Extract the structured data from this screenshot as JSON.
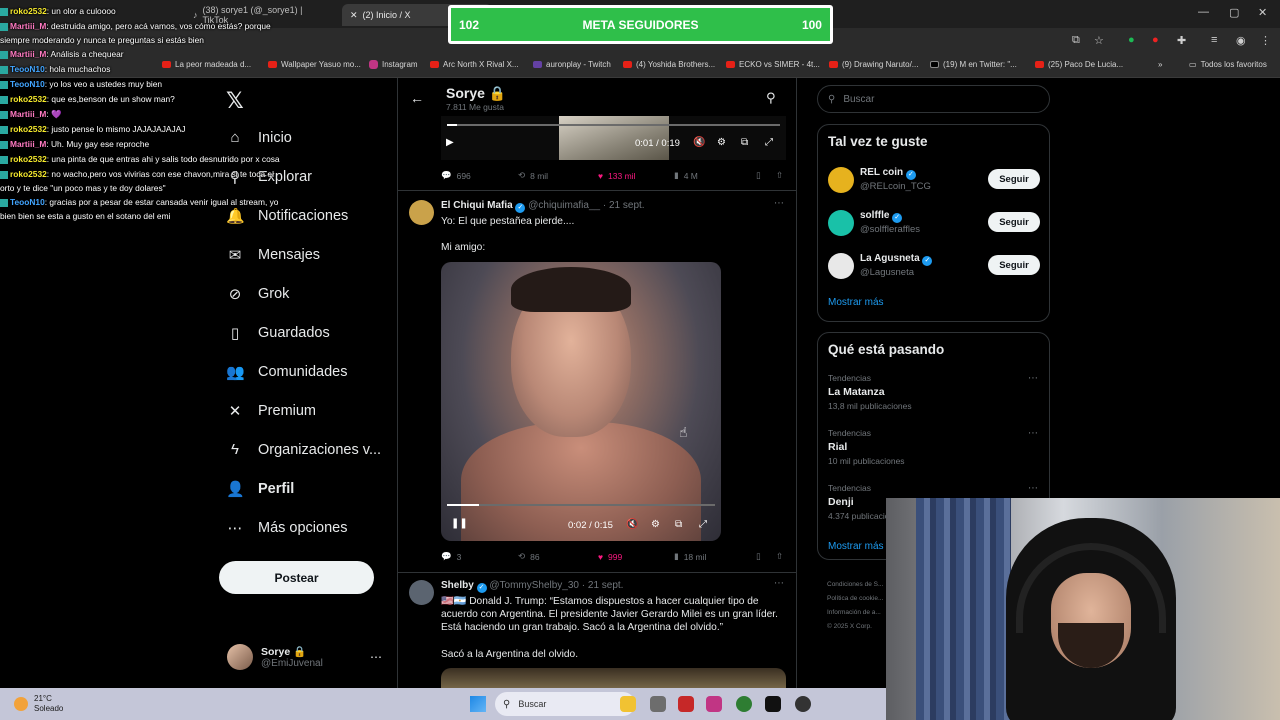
{
  "browser": {
    "tabs": [
      {
        "label": "(38) sorye1 (@_sorye1) | TikTok",
        "active": false
      },
      {
        "label": "(2) Inicio / X",
        "active": true
      }
    ],
    "bookmarks": [
      "La peor madeada d...",
      "Wallpaper Yasuo mo...",
      "Instagram",
      "Arc North X Rival X...",
      "auronplay - Twitch",
      "(4) Yoshida Brothers...",
      "ECKO vs SIMER - 4t...",
      "(9) Drawing Naruto/...",
      "(19) M en Twitter: \"...",
      "(25) Paco De Lucia...",
      "Todos los favoritos"
    ]
  },
  "goal": {
    "left": "102",
    "label": "META SEGUIDORES",
    "right": "100"
  },
  "chat": [
    {
      "user": "roko2532",
      "msg": ": un olor a culoooo",
      "color": "roko"
    },
    {
      "user": "Martiii_M",
      "msg": ": destruida amigo, pero acá vamos, vos cómo estás? porque siempre moderando y nunca te preguntas si estás bien",
      "color": "mar",
      "wrap": true
    },
    {
      "user": "Martiii_M",
      "msg": ": Análisis a chequear",
      "color": "mar"
    },
    {
      "user": "TeooN10",
      "msg": ": hola muchachos",
      "color": "teo"
    },
    {
      "user": "TeooN10",
      "msg": ": yo los veo a ustedes muy bien",
      "color": "teo"
    },
    {
      "user": "roko2532",
      "msg": ": que es,benson de un show man?",
      "color": "roko"
    },
    {
      "user": "Martiii_M",
      "msg": ": 💜",
      "color": "mar"
    },
    {
      "user": "roko2532",
      "msg": ": justo pense lo mismo JAJAJAJAJAJ",
      "color": "roko"
    },
    {
      "user": "Martiii_M",
      "msg": ": Uh. Muy gay ese reproche",
      "color": "mar"
    },
    {
      "user": "roko2532",
      "msg": ": una pinta de que entras ahi y salis todo desnutrido por x cosa",
      "color": "roko"
    },
    {
      "user": "roko2532",
      "msg": ": no wacho,pero vos vivirias con ese chavon,mira si te toca el orto y te dice \"un poco mas y te doy dolares\"",
      "color": "roko",
      "wrap": true
    },
    {
      "user": "TeooN10",
      "msg": ": gracias por a pesar de estar cansada venir igual al stream, yo bien bien se esta a gusto en el sotano del emi",
      "color": "teo",
      "wrap": true
    }
  ],
  "nav": {
    "items": [
      {
        "label": "Inicio",
        "icon": "home-icon",
        "glyph": "⌂"
      },
      {
        "label": "Explorar",
        "icon": "search-icon",
        "glyph": "⚲"
      },
      {
        "label": "Notificaciones",
        "icon": "bell-icon",
        "glyph": "🔔"
      },
      {
        "label": "Mensajes",
        "icon": "mail-icon",
        "glyph": "✉"
      },
      {
        "label": "Grok",
        "icon": "grok-icon",
        "glyph": "⊘"
      },
      {
        "label": "Guardados",
        "icon": "bookmark-icon",
        "glyph": "▯"
      },
      {
        "label": "Comunidades",
        "icon": "communities-icon",
        "glyph": "👥"
      },
      {
        "label": "Premium",
        "icon": "x-premium-icon",
        "glyph": "✕"
      },
      {
        "label": "Organizaciones v...",
        "icon": "lightning-icon",
        "glyph": "ϟ"
      },
      {
        "label": "Perfil",
        "icon": "person-icon",
        "glyph": "👤"
      },
      {
        "label": "Más opciones",
        "icon": "more-circle-icon",
        "glyph": "⋯"
      }
    ],
    "post_label": "Postear",
    "account": {
      "name": "Sorye 🔒",
      "handle": "@EmiJuvenal"
    }
  },
  "profile_header": {
    "title": "Sorye 🔒",
    "subtitle": "7.811 Me gusta"
  },
  "tweet1": {
    "video_time": "0:01 / 0:19",
    "replies": "696",
    "reposts": "8 mil",
    "likes": "133 mil",
    "views": "4 M",
    "progress": 0.03
  },
  "tweet2": {
    "name": "El Chiqui Mafia",
    "handle": "@chiquimafia__ · 21 sept.",
    "text1": "Yo: El que pestañea pierde....",
    "text2": "Mi amigo:",
    "video_time": "0:02 / 0:15",
    "replies": "3",
    "reposts": "86",
    "likes": "999",
    "views": "18 mil",
    "progress": 0.12
  },
  "tweet3": {
    "name": "Shelby",
    "handle": "@TommyShelby_30 · 21 sept.",
    "text1": "🇺🇸🇦🇷 Donald J. Trump: “Estamos dispuestos a hacer cualquier tipo de acuerdo con Argentina. El presidente Javier Gerardo Milei es un gran líder. Está haciendo un gran trabajo. Sacó a la Argentina del olvido.”",
    "text2": "Sacó a la Argentina del olvido."
  },
  "sidebar": {
    "search_placeholder": "Buscar",
    "suggest_title": "Tal vez te guste",
    "suggestions": [
      {
        "name": "REL coin",
        "handle": "@RELcoin_TCG",
        "button": "Seguir",
        "color": "#e6b21e"
      },
      {
        "name": "solffle",
        "handle": "@solffleraffles",
        "button": "Seguir",
        "color": "#19c1a8"
      },
      {
        "name": "La Agusneta",
        "handle": "@Lagusneta",
        "button": "Seguir",
        "color": "#e8e8e8"
      }
    ],
    "show_more": "Mostrar más",
    "trends_title": "Qué está pasando",
    "trends": [
      {
        "category": "Tendencias",
        "name": "La Matanza",
        "posts": "13,8 mil publicaciones"
      },
      {
        "category": "Tendencias",
        "name": "Rial",
        "posts": "10 mil publicaciones"
      },
      {
        "category": "Tendencias",
        "name": "Denji",
        "posts": "4.374 publicaciones"
      }
    ],
    "trends_more": "Mostrar más",
    "footer": [
      "Condiciones de S...",
      "Política de cookie...",
      "Información de a...",
      "© 2025 X Corp."
    ]
  },
  "taskbar": {
    "temp": "21°C",
    "weather": "Soleado",
    "search_placeholder": "Buscar"
  },
  "colors": {
    "accent": "#1d9bf0",
    "like": "#f91880",
    "goal": "#2fbf4a"
  }
}
